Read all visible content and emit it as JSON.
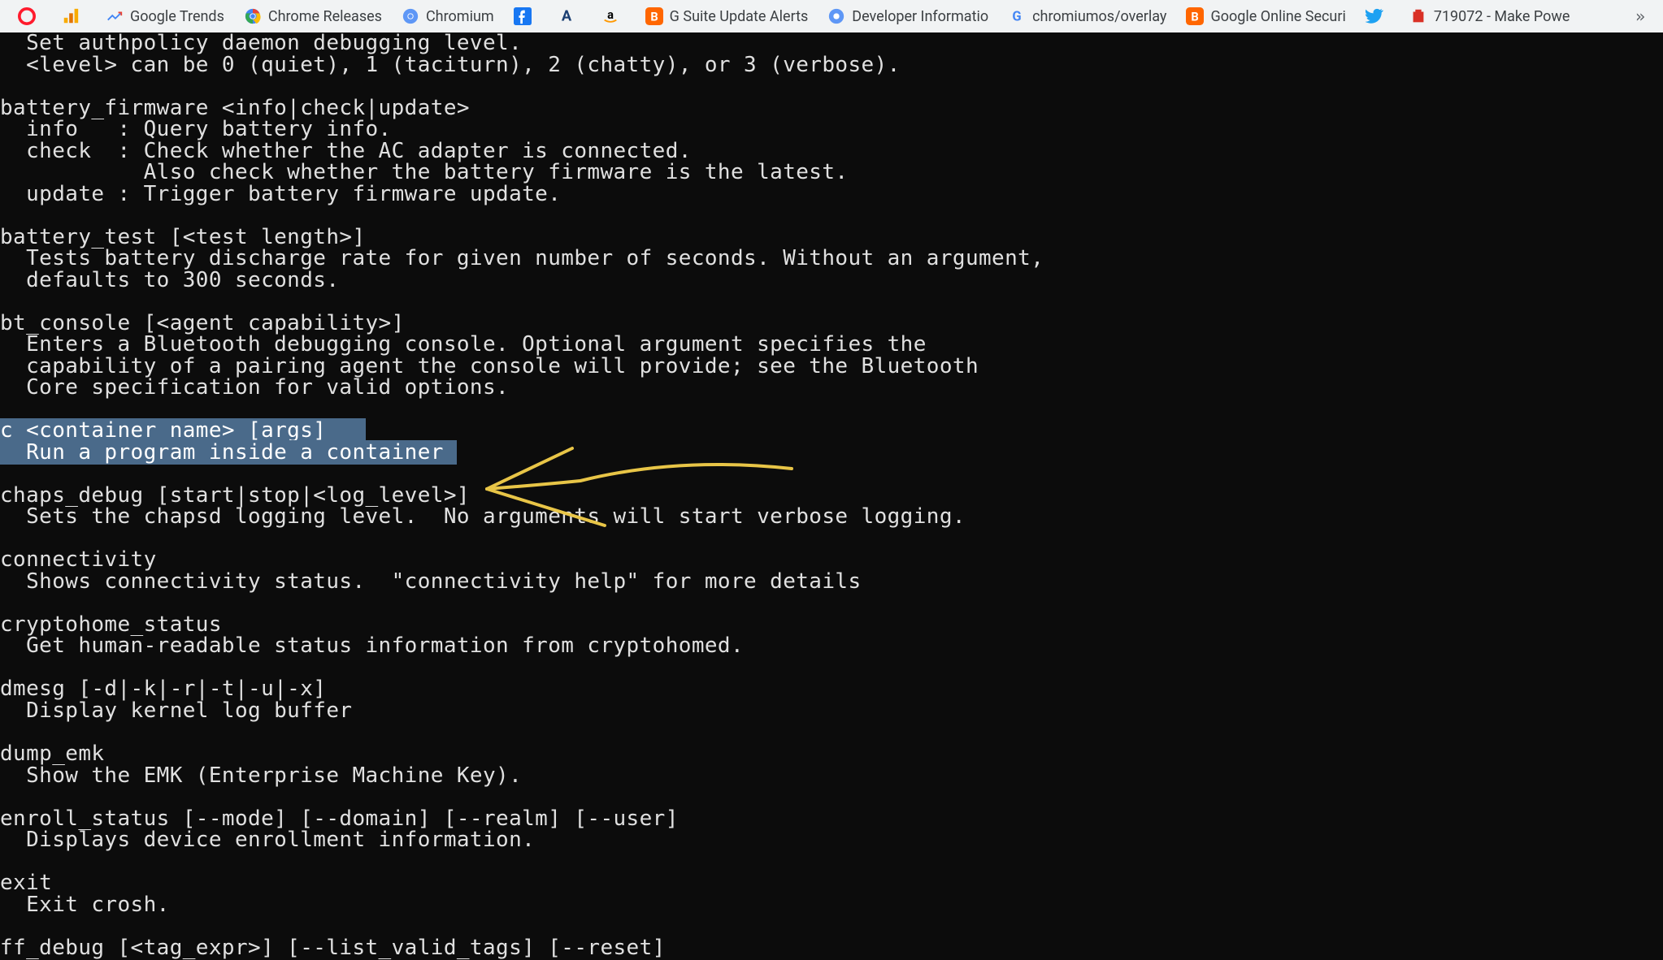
{
  "bookmarks": [
    {
      "label": "",
      "icon": "opera-icon"
    },
    {
      "label": "",
      "icon": "analytics-icon"
    },
    {
      "label": "Google Trends",
      "icon": "trends-icon"
    },
    {
      "label": "Chrome Releases",
      "icon": "chrome-icon"
    },
    {
      "label": "Chromium",
      "icon": "chromium-icon"
    },
    {
      "label": "",
      "icon": "facebook-icon"
    },
    {
      "label": "",
      "icon": "a-icon"
    },
    {
      "label": "",
      "icon": "amazon-icon"
    },
    {
      "label": "G Suite Update Alerts",
      "icon": "blogger-icon"
    },
    {
      "label": "Developer Informatio",
      "icon": "chromium-icon"
    },
    {
      "label": "chromiumos/overlay",
      "icon": "google-icon"
    },
    {
      "label": "Google Online Securi",
      "icon": "blogger-icon"
    },
    {
      "label": "",
      "icon": "twitter-icon"
    },
    {
      "label": "719072 - Make Powe",
      "icon": "bug-icon"
    }
  ],
  "overflow_glyph": "»",
  "terminal": {
    "lines_before": "  Set authpolicy daemon debugging level.\n  <level> can be 0 (quiet), 1 (taciturn), 2 (chatty), or 3 (verbose).\n\nbattery_firmware <info|check|update>\n  info   : Query battery info.\n  check  : Check whether the AC adapter is connected.\n           Also check whether the battery firmware is the latest.\n  update : Trigger battery firmware update.\n\nbattery_test [<test length>]\n  Tests battery discharge rate for given number of seconds. Without an argument,\n  defaults to 300 seconds.\n\nbt_console [<agent capability>]\n  Enters a Bluetooth debugging console. Optional argument specifies the\n  capability of a pairing agent the console will provide; see the Bluetooth\n  Core specification for valid options.\n",
    "highlight_line1": "c <container name> [args]   ",
    "highlight_line2": "  Run a program inside a container ",
    "lines_after": "\nchaps_debug [start|stop|<log_level>]\n  Sets the chapsd logging level.  No arguments will start verbose logging.\n\nconnectivity\n  Shows connectivity status.  \"connectivity help\" for more details\n\ncryptohome_status\n  Get human-readable status information from cryptohomed.\n\ndmesg [-d|-k|-r|-t|-u|-x]\n  Display kernel log buffer\n\ndump_emk\n  Show the EMK (Enterprise Machine Key).\n\nenroll_status [--mode] [--domain] [--realm] [--user]\n  Displays device enrollment information.\n\nexit\n  Exit crosh.\n\nff_debug [<tag_expr>] [--list_valid_tags] [--reset]"
  }
}
